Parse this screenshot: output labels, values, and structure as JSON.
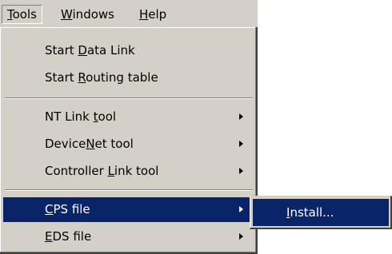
{
  "menubar": {
    "items": [
      {
        "pre": "",
        "key": "T",
        "post": "ools"
      },
      {
        "pre": "",
        "key": "W",
        "post": "indows"
      },
      {
        "pre": "",
        "key": "H",
        "post": "elp"
      }
    ]
  },
  "tools_menu": {
    "items": [
      {
        "pre": "Start ",
        "key": "D",
        "post": "ata Link",
        "submenu": false
      },
      {
        "pre": "Start ",
        "key": "R",
        "post": "outing table",
        "submenu": false
      },
      {
        "pre": "NT Link ",
        "key": "t",
        "post": "ool",
        "submenu": true
      },
      {
        "pre": "Device",
        "key": "N",
        "post": "et tool",
        "submenu": true
      },
      {
        "pre": "Controller ",
        "key": "L",
        "post": "ink tool",
        "submenu": true
      },
      {
        "pre": "",
        "key": "C",
        "post": "PS file",
        "submenu": true,
        "highlighted": true
      },
      {
        "pre": "",
        "key": "E",
        "post": "DS file",
        "submenu": true
      }
    ]
  },
  "cps_submenu": {
    "items": [
      {
        "pre": "",
        "key": "I",
        "post": "nstall...",
        "highlighted": true
      }
    ]
  },
  "colors": {
    "menu_background": "#d4d0c8",
    "highlight": "#0a246a",
    "highlight_text": "#ffffff"
  },
  "icons": {
    "submenu_arrow": "triangle-right"
  }
}
